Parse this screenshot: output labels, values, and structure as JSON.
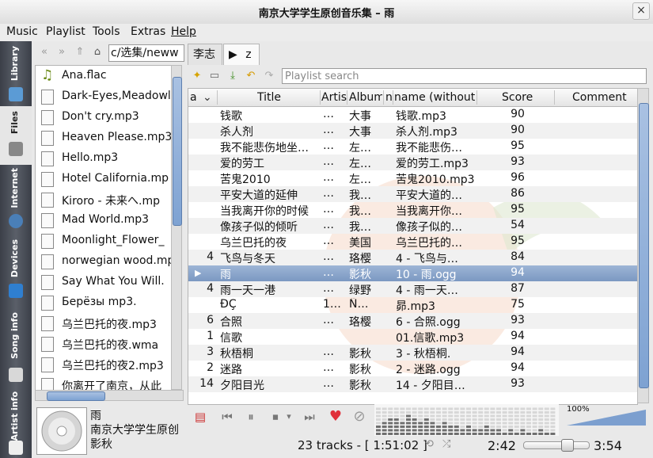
{
  "window": {
    "title": "南京大学学生原创音乐集 – 雨",
    "close_icon": "×"
  },
  "menu": [
    "Music",
    "Playlist",
    "Tools",
    "Extras",
    "Help"
  ],
  "side_tabs": [
    {
      "label": "Library",
      "icon": "library-icon"
    },
    {
      "label": "Files",
      "icon": "files-icon"
    },
    {
      "label": "Internet",
      "icon": "internet-icon"
    },
    {
      "label": "Devices",
      "icon": "devices-icon"
    },
    {
      "label": "Song info",
      "icon": "song-info-icon"
    },
    {
      "label": "Artist info",
      "icon": "artist-info-icon"
    }
  ],
  "files": {
    "path": "c/选集/neww",
    "items": [
      "Ana.flac",
      "Dark-Eyes,Meadowla",
      "Don't cry.mp3",
      "Heaven Please.mp3",
      "Hello.mp3",
      "Hotel California.mp",
      "Kiroro - 未来へ.mp",
      "Mad World.mp3",
      "Moonlight_Flower_",
      "norwegian wood.mp",
      "Say What You Will.",
      "Берёзы mp3.",
      "乌兰巴托的夜.mp3",
      "乌兰巴托的夜.wma",
      "乌兰巴托的夜2.mp3",
      "你离开了南京，从此"
    ]
  },
  "now_playing": {
    "title": "雨",
    "album": "南京大学学生原创",
    "artist": "影秋"
  },
  "playlist_tabs": [
    "李志",
    "z"
  ],
  "search": {
    "placeholder": "Playlist search"
  },
  "columns": [
    "a",
    "Title",
    "Artist",
    "Album",
    "n",
    "name (without",
    "Score",
    "Comment"
  ],
  "tracks": [
    {
      "no": "",
      "title": "钱歌",
      "artist": "…",
      "album": "大事",
      "file": "钱歌.mp3",
      "score": "90"
    },
    {
      "no": "",
      "title": "杀人剂",
      "artist": "…",
      "album": "大事",
      "file": "杀人剂.mp3",
      "score": "90"
    },
    {
      "no": "",
      "title": "我不能悲伤地坐…",
      "artist": "…",
      "album": "左…",
      "file": "我不能悲伤…",
      "score": "95"
    },
    {
      "no": "",
      "title": "爱的劳工",
      "artist": "…",
      "album": "左…",
      "file": "爱的劳工.mp3",
      "score": "93"
    },
    {
      "no": "",
      "title": "苦鬼2010",
      "artist": "…",
      "album": "左…",
      "file": "苦鬼2010.mp3",
      "score": "96"
    },
    {
      "no": "",
      "title": "平安大道的延伸",
      "artist": "…",
      "album": "我…",
      "file": "平安大道的…",
      "score": "86"
    },
    {
      "no": "",
      "title": "当我离开你的时候",
      "artist": "…",
      "album": "我…",
      "file": "当我离开你…",
      "score": "95"
    },
    {
      "no": "",
      "title": "像孩子似的倾听",
      "artist": "…",
      "album": "我…",
      "file": "像孩子似的…",
      "score": "54"
    },
    {
      "no": "",
      "title": "乌兰巴托的夜",
      "artist": "…",
      "album": "美国",
      "file": "乌兰巴托的…",
      "score": "95"
    },
    {
      "no": "4",
      "title": "飞鸟与冬天",
      "artist": "…",
      "album": "珞樱",
      "file": "4 - 飞鸟与…",
      "score": "84"
    },
    {
      "no": "",
      "title": "雨",
      "artist": "…",
      "album": "影秋",
      "file": "10 - 雨.ogg",
      "score": "94"
    },
    {
      "no": "4",
      "title": "雨一天一港",
      "artist": "…",
      "album": "绿野",
      "file": "4 - 雨一天…",
      "score": "87"
    },
    {
      "no": "",
      "title": "ĐÇ",
      "artist": "1…",
      "album": "Ñ…",
      "file": "昴.mp3",
      "score": "75"
    },
    {
      "no": "6",
      "title": "合照",
      "artist": "…",
      "album": "珞樱",
      "file": "6 - 合照.ogg",
      "score": "93"
    },
    {
      "no": "1",
      "title": "信歌",
      "artist": "",
      "album": "",
      "file": "01.信歌.mp3",
      "score": "94"
    },
    {
      "no": "3",
      "title": "秋梧桐",
      "artist": "…",
      "album": "影秋",
      "file": "3 - 秋梧桐.",
      "score": "94"
    },
    {
      "no": "2",
      "title": "迷路",
      "artist": "…",
      "album": "影秋",
      "file": "2 - 迷路.ogg",
      "score": "94"
    },
    {
      "no": "14",
      "title": "夕阳目光",
      "artist": "…",
      "album": "影秋",
      "file": "14 - 夕阳目…",
      "score": "93"
    }
  ],
  "playing_index": 10,
  "volume": "100%",
  "volume_level": 1.0,
  "status": {
    "tracks": "23 tracks - [ 1:51:02 ]",
    "elapsed": "2:42",
    "total": "3:54",
    "seek_fraction": 0.69
  }
}
